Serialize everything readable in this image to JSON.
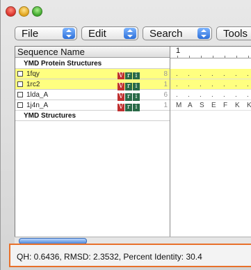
{
  "menus": [
    {
      "label": "File"
    },
    {
      "label": "Edit"
    },
    {
      "label": "Search"
    },
    {
      "label": "Tools"
    }
  ],
  "header": {
    "sequence_name": "Sequence Name",
    "ruler_label": "1"
  },
  "groups": {
    "protein": "YMD Protein Structures",
    "structures": "YMD Structures"
  },
  "sequences": [
    {
      "name": "1fqy",
      "num": "8",
      "highlight": true,
      "residues": [
        ".",
        ".",
        ".",
        ".",
        ".",
        ".",
        "."
      ]
    },
    {
      "name": "1rc2",
      "num": "1",
      "highlight": true,
      "residues": [
        ".",
        ".",
        ".",
        ".",
        ".",
        ".",
        "."
      ]
    },
    {
      "name": "1lda_A",
      "num": "6",
      "highlight": false,
      "residues": [
        ".",
        ".",
        ".",
        ".",
        ".",
        ".",
        "."
      ]
    },
    {
      "name": "1j4n_A",
      "num": "1",
      "highlight": false,
      "residues": [
        "M",
        "A",
        "S",
        "E",
        "F",
        "K",
        "K"
      ]
    }
  ],
  "badges": {
    "v": "V",
    "r": "r",
    "i": "i"
  },
  "status": {
    "text": "QH: 0.6436, RMSD: 2.3532, Percent Identity: 30.4"
  },
  "colors": {
    "highlight": "#ffff80",
    "status_border": "#e8702a"
  }
}
